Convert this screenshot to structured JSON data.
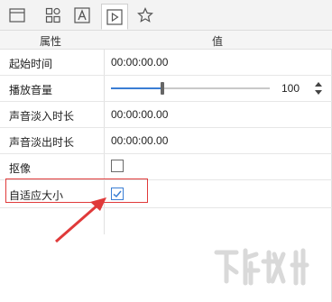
{
  "tabs": [
    {
      "icon": "window-icon",
      "active": false
    },
    {
      "icon": "grid-icon",
      "active": false
    },
    {
      "icon": "text-a-icon",
      "active": false
    },
    {
      "icon": "play-icon",
      "active": true
    },
    {
      "icon": "star-icon",
      "active": false
    }
  ],
  "table": {
    "header_property": "属性",
    "header_value": "值"
  },
  "rows": {
    "start_time": {
      "label": "起始时间",
      "value": "00:00:00.00"
    },
    "volume": {
      "label": "播放音量",
      "value": "100",
      "level_percent": 100
    },
    "fade_in": {
      "label": "声音淡入时长",
      "value": "00:00:00.00"
    },
    "fade_out": {
      "label": "声音淡出时长",
      "value": "00:00:00.00"
    },
    "chroma": {
      "label": "抠像",
      "checked": false
    },
    "auto_fit": {
      "label": "自适应大小",
      "checked": true
    }
  },
  "colors": {
    "accent": "#3a7ed4",
    "highlight": "#e03a3a"
  }
}
